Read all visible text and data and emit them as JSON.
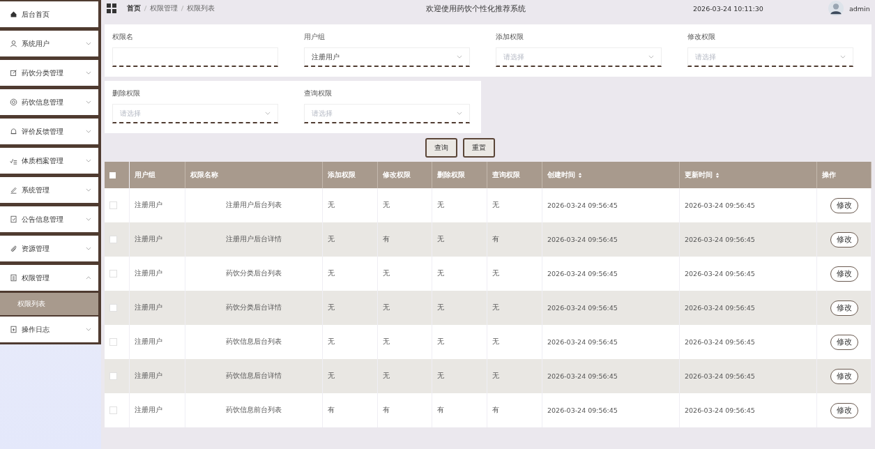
{
  "sidebar": {
    "items": [
      {
        "label": "后台首页",
        "kind": "link"
      },
      {
        "label": "系统用户",
        "kind": "menu",
        "expanded": false
      },
      {
        "label": "药饮分类管理",
        "kind": "menu",
        "expanded": false
      },
      {
        "label": "药饮信息管理",
        "kind": "menu",
        "expanded": false
      },
      {
        "label": "评价反馈管理",
        "kind": "menu",
        "expanded": false
      },
      {
        "label": "体质档案管理",
        "kind": "menu",
        "expanded": false
      },
      {
        "label": "系统管理",
        "kind": "menu",
        "expanded": false
      },
      {
        "label": "公告信息管理",
        "kind": "menu",
        "expanded": false
      },
      {
        "label": "资源管理",
        "kind": "menu",
        "expanded": false
      },
      {
        "label": "权限管理",
        "kind": "menu",
        "expanded": true,
        "children": [
          {
            "label": "权限列表",
            "selected": true
          }
        ]
      },
      {
        "label": "操作日志",
        "kind": "menu",
        "expanded": false
      }
    ]
  },
  "breadcrumb": [
    "首页",
    "权限管理",
    "权限列表"
  ],
  "header": {
    "title": "欢迎使用药饮个性化推荐系统",
    "datetime": "2026-03-24 10:11:30",
    "user": "admin"
  },
  "filters": [
    {
      "label": "权限名",
      "kind": "input"
    },
    {
      "label": "用户组",
      "kind": "select",
      "value": "注册用户"
    },
    {
      "label": "添加权限",
      "kind": "select",
      "placeholder": "请选择"
    },
    {
      "label": "修改权限",
      "kind": "select",
      "placeholder": "请选择"
    },
    {
      "label": "删除权限",
      "kind": "select",
      "placeholder": "请选择"
    },
    {
      "label": "查询权限",
      "kind": "select",
      "placeholder": "请选择"
    }
  ],
  "buttons": [
    "查询",
    "重置"
  ],
  "table": {
    "select_all_checked": false,
    "columns": [
      {
        "label": "用户组",
        "sortable": false
      },
      {
        "label": "权限名称",
        "sortable": false
      },
      {
        "label": "添加权限",
        "sortable": false
      },
      {
        "label": "修改权限",
        "sortable": false
      },
      {
        "label": "删除权限",
        "sortable": false
      },
      {
        "label": "查询权限",
        "sortable": false
      },
      {
        "label": "创建时间",
        "sortable": true
      },
      {
        "label": "更新时间",
        "sortable": true
      },
      {
        "label": "操作",
        "sortable": false
      }
    ],
    "rows": [
      {
        "checked": false,
        "cells": [
          "注册用户",
          "注册用户后台列表",
          "无",
          "无",
          "无",
          "无",
          "2026-03-24 09:56:45",
          "2026-03-24 09:56:45"
        ],
        "action": "修改"
      },
      {
        "checked": false,
        "cells": [
          "注册用户",
          "注册用户后台详情",
          "无",
          "有",
          "无",
          "有",
          "2026-03-24 09:56:45",
          "2026-03-24 09:56:45"
        ],
        "action": "修改"
      },
      {
        "checked": false,
        "cells": [
          "注册用户",
          "药饮分类后台列表",
          "无",
          "无",
          "无",
          "无",
          "2026-03-24 09:56:45",
          "2026-03-24 09:56:45"
        ],
        "action": "修改"
      },
      {
        "checked": false,
        "cells": [
          "注册用户",
          "药饮分类后台详情",
          "无",
          "无",
          "无",
          "无",
          "2026-03-24 09:56:45",
          "2026-03-24 09:56:45"
        ],
        "action": "修改"
      },
      {
        "checked": false,
        "cells": [
          "注册用户",
          "药饮信息后台列表",
          "无",
          "无",
          "无",
          "无",
          "2026-03-24 09:56:45",
          "2026-03-24 09:56:45"
        ],
        "action": "修改"
      },
      {
        "checked": false,
        "cells": [
          "注册用户",
          "药饮信息后台详情",
          "无",
          "无",
          "无",
          "无",
          "2026-03-24 09:56:45",
          "2026-03-24 09:56:45"
        ],
        "action": "修改"
      },
      {
        "checked": false,
        "cells": [
          "注册用户",
          "药饮信息前台列表",
          "有",
          "有",
          "有",
          "有",
          "2026-03-24 09:56:45",
          "2026-03-24 09:56:45"
        ],
        "action": "修改"
      }
    ]
  }
}
